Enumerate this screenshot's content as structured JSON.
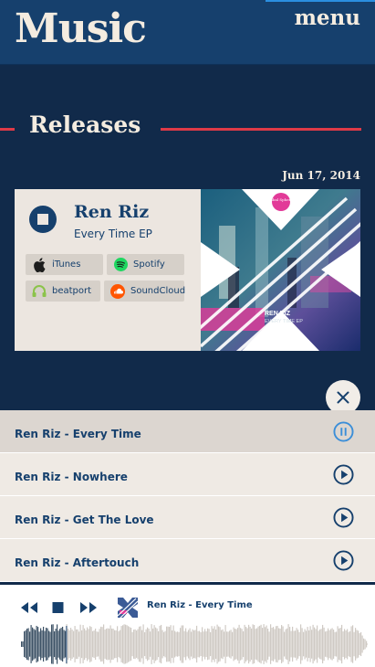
{
  "header": {
    "logo": "Music",
    "menu_label": "menu"
  },
  "section": {
    "title": "Releases"
  },
  "release": {
    "date": "Jun 17, 2014",
    "artist": "Ren Riz",
    "title": "Every Time EP",
    "stores": [
      {
        "label": "iTunes",
        "icon": "apple-icon"
      },
      {
        "label": "Spotify",
        "icon": "spotify-icon"
      },
      {
        "label": "beatport",
        "icon": "beatport-icon"
      },
      {
        "label": "SoundCloud",
        "icon": "soundcloud-icon"
      }
    ],
    "cover": {
      "label_logo": "Tribal Spheres",
      "artist": "REN RIZ",
      "title": "EVERY TIME EP"
    }
  },
  "playlist": {
    "tracks": [
      {
        "name": "Ren Riz - Every Time",
        "state": "playing"
      },
      {
        "name": "Ren Riz - Nowhere",
        "state": "paused"
      },
      {
        "name": "Ren Riz - Get The Love",
        "state": "paused"
      },
      {
        "name": "Ren Riz - Aftertouch",
        "state": "paused"
      }
    ]
  },
  "player": {
    "now_playing": "Ren Riz - Every Time",
    "progress": 0.13
  },
  "colors": {
    "navy": "#16406d",
    "accent": "#de3a47",
    "cream": "#f4ece0",
    "card": "#ece6e0",
    "playing": "#3b8ed8"
  }
}
